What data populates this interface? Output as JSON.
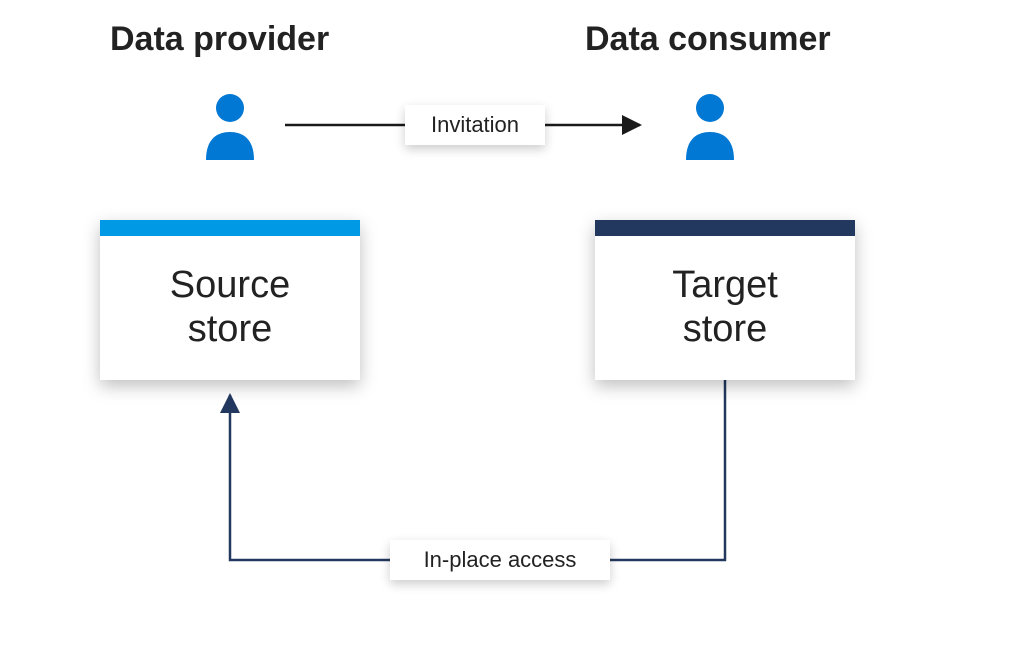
{
  "titles": {
    "provider": "Data provider",
    "consumer": "Data consumer"
  },
  "people": {
    "provider_color": "#0078d4",
    "consumer_color": "#0078d4"
  },
  "stores": {
    "source": {
      "line1": "Source",
      "line2": "store",
      "stripe": "#0099e5"
    },
    "target": {
      "line1": "Target",
      "line2": "store",
      "stripe": "#22385f"
    }
  },
  "labels": {
    "invitation": "Invitation",
    "inplace": "In-place access"
  },
  "arrows": {
    "top_color": "#1a1a1a",
    "bottom_color": "#22385f"
  }
}
